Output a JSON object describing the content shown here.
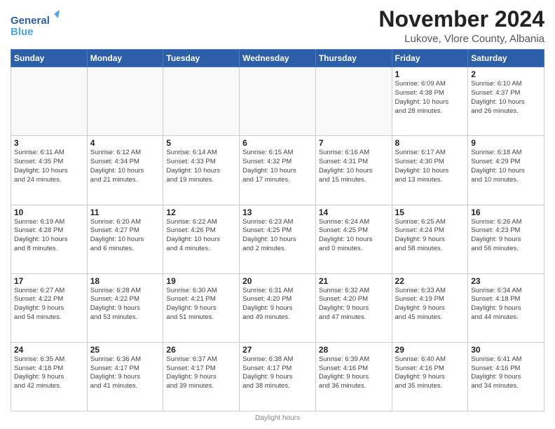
{
  "logo": {
    "line1": "General",
    "line2": "Blue"
  },
  "title": "November 2024",
  "subtitle": "Lukove, Vlore County, Albania",
  "days_of_week": [
    "Sunday",
    "Monday",
    "Tuesday",
    "Wednesday",
    "Thursday",
    "Friday",
    "Saturday"
  ],
  "footer": "Daylight hours",
  "weeks": [
    [
      {
        "day": "",
        "info": ""
      },
      {
        "day": "",
        "info": ""
      },
      {
        "day": "",
        "info": ""
      },
      {
        "day": "",
        "info": ""
      },
      {
        "day": "",
        "info": ""
      },
      {
        "day": "1",
        "info": "Sunrise: 6:09 AM\nSunset: 4:38 PM\nDaylight: 10 hours\nand 28 minutes."
      },
      {
        "day": "2",
        "info": "Sunrise: 6:10 AM\nSunset: 4:37 PM\nDaylight: 10 hours\nand 26 minutes."
      }
    ],
    [
      {
        "day": "3",
        "info": "Sunrise: 6:11 AM\nSunset: 4:35 PM\nDaylight: 10 hours\nand 24 minutes."
      },
      {
        "day": "4",
        "info": "Sunrise: 6:12 AM\nSunset: 4:34 PM\nDaylight: 10 hours\nand 21 minutes."
      },
      {
        "day": "5",
        "info": "Sunrise: 6:14 AM\nSunset: 4:33 PM\nDaylight: 10 hours\nand 19 minutes."
      },
      {
        "day": "6",
        "info": "Sunrise: 6:15 AM\nSunset: 4:32 PM\nDaylight: 10 hours\nand 17 minutes."
      },
      {
        "day": "7",
        "info": "Sunrise: 6:16 AM\nSunset: 4:31 PM\nDaylight: 10 hours\nand 15 minutes."
      },
      {
        "day": "8",
        "info": "Sunrise: 6:17 AM\nSunset: 4:30 PM\nDaylight: 10 hours\nand 13 minutes."
      },
      {
        "day": "9",
        "info": "Sunrise: 6:18 AM\nSunset: 4:29 PM\nDaylight: 10 hours\nand 10 minutes."
      }
    ],
    [
      {
        "day": "10",
        "info": "Sunrise: 6:19 AM\nSunset: 4:28 PM\nDaylight: 10 hours\nand 8 minutes."
      },
      {
        "day": "11",
        "info": "Sunrise: 6:20 AM\nSunset: 4:27 PM\nDaylight: 10 hours\nand 6 minutes."
      },
      {
        "day": "12",
        "info": "Sunrise: 6:22 AM\nSunset: 4:26 PM\nDaylight: 10 hours\nand 4 minutes."
      },
      {
        "day": "13",
        "info": "Sunrise: 6:23 AM\nSunset: 4:25 PM\nDaylight: 10 hours\nand 2 minutes."
      },
      {
        "day": "14",
        "info": "Sunrise: 6:24 AM\nSunset: 4:25 PM\nDaylight: 10 hours\nand 0 minutes."
      },
      {
        "day": "15",
        "info": "Sunrise: 6:25 AM\nSunset: 4:24 PM\nDaylight: 9 hours\nand 58 minutes."
      },
      {
        "day": "16",
        "info": "Sunrise: 6:26 AM\nSunset: 4:23 PM\nDaylight: 9 hours\nand 56 minutes."
      }
    ],
    [
      {
        "day": "17",
        "info": "Sunrise: 6:27 AM\nSunset: 4:22 PM\nDaylight: 9 hours\nand 54 minutes."
      },
      {
        "day": "18",
        "info": "Sunrise: 6:28 AM\nSunset: 4:22 PM\nDaylight: 9 hours\nand 53 minutes."
      },
      {
        "day": "19",
        "info": "Sunrise: 6:30 AM\nSunset: 4:21 PM\nDaylight: 9 hours\nand 51 minutes."
      },
      {
        "day": "20",
        "info": "Sunrise: 6:31 AM\nSunset: 4:20 PM\nDaylight: 9 hours\nand 49 minutes."
      },
      {
        "day": "21",
        "info": "Sunrise: 6:32 AM\nSunset: 4:20 PM\nDaylight: 9 hours\nand 47 minutes."
      },
      {
        "day": "22",
        "info": "Sunrise: 6:33 AM\nSunset: 4:19 PM\nDaylight: 9 hours\nand 45 minutes."
      },
      {
        "day": "23",
        "info": "Sunrise: 6:34 AM\nSunset: 4:18 PM\nDaylight: 9 hours\nand 44 minutes."
      }
    ],
    [
      {
        "day": "24",
        "info": "Sunrise: 6:35 AM\nSunset: 4:18 PM\nDaylight: 9 hours\nand 42 minutes."
      },
      {
        "day": "25",
        "info": "Sunrise: 6:36 AM\nSunset: 4:17 PM\nDaylight: 9 hours\nand 41 minutes."
      },
      {
        "day": "26",
        "info": "Sunrise: 6:37 AM\nSunset: 4:17 PM\nDaylight: 9 hours\nand 39 minutes."
      },
      {
        "day": "27",
        "info": "Sunrise: 6:38 AM\nSunset: 4:17 PM\nDaylight: 9 hours\nand 38 minutes."
      },
      {
        "day": "28",
        "info": "Sunrise: 6:39 AM\nSunset: 4:16 PM\nDaylight: 9 hours\nand 36 minutes."
      },
      {
        "day": "29",
        "info": "Sunrise: 6:40 AM\nSunset: 4:16 PM\nDaylight: 9 hours\nand 35 minutes."
      },
      {
        "day": "30",
        "info": "Sunrise: 6:41 AM\nSunset: 4:16 PM\nDaylight: 9 hours\nand 34 minutes."
      }
    ]
  ]
}
